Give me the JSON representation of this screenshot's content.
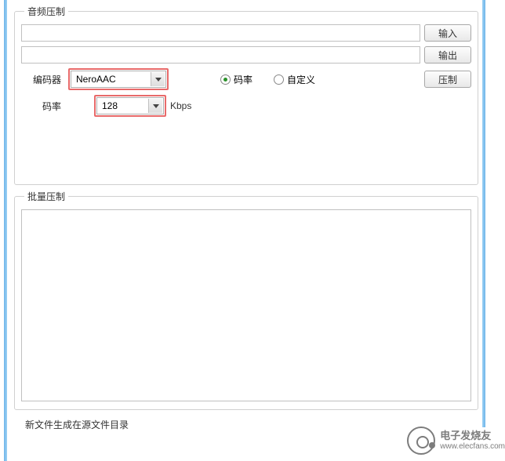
{
  "audio_group": {
    "legend": "音频压制",
    "input_value": "",
    "output_value": "",
    "input_btn": "输入",
    "output_btn": "输出",
    "encoder_label": "编码器",
    "encoder_value": "NeroAAC",
    "radio_bitrate": "码率",
    "radio_custom": "自定义",
    "encode_btn": "压制",
    "bitrate_label": "码率",
    "bitrate_value": "128",
    "bitrate_unit": "Kbps"
  },
  "batch_group": {
    "legend": "批量压制"
  },
  "cutoff_legend": "新文件生成在源文件目录",
  "watermark": {
    "cn": "电子发烧友",
    "url": "www.elecfans.com"
  }
}
